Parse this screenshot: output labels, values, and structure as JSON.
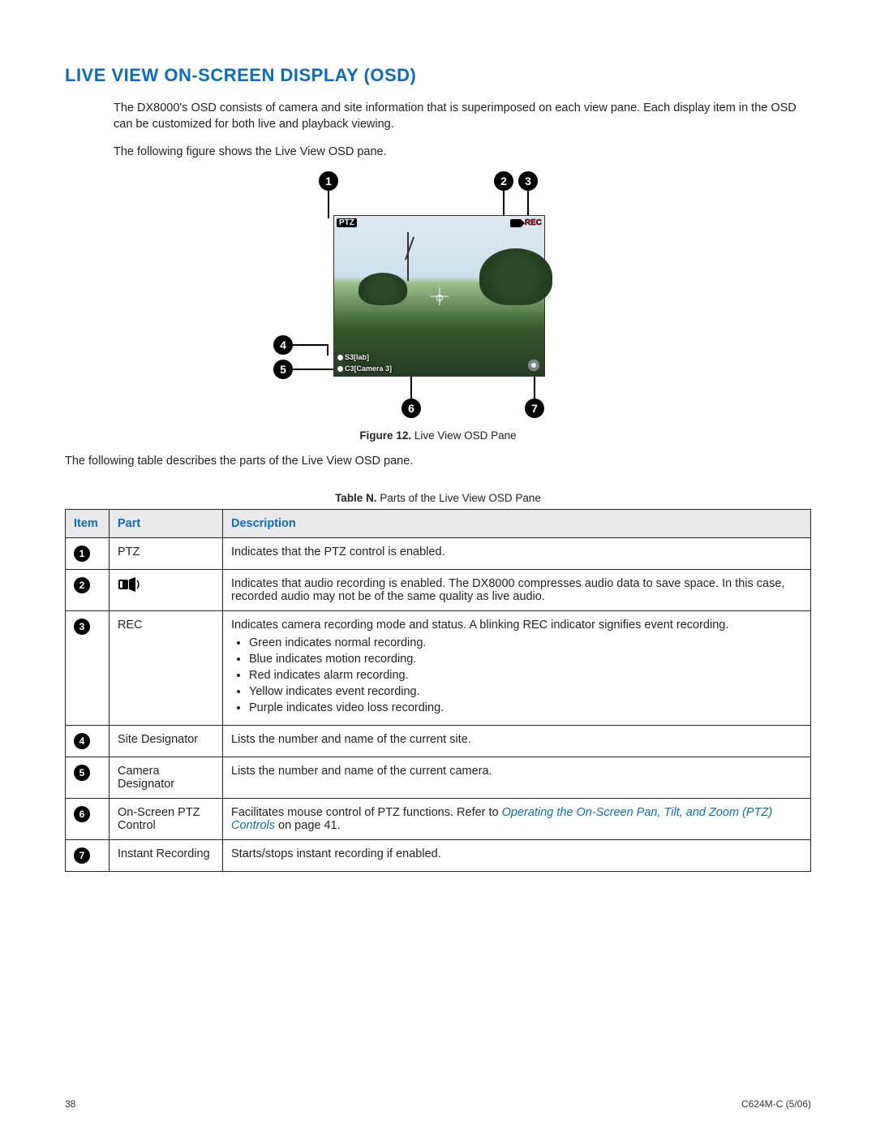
{
  "heading": "LIVE VIEW ON-SCREEN DISPLAY (OSD)",
  "intro1": "The DX8000's OSD consists of camera and site information that is superimposed on each view pane. Each display item in the OSD can be customized for both live and playback viewing.",
  "intro2": "The following figure shows the Live View OSD pane.",
  "osd_overlay": {
    "ptz": "PTZ",
    "rec": "REC",
    "site_label": "S3[lab]",
    "camera_label": "C3[Camera 3]"
  },
  "figure_label_prefix": "Figure 12.",
  "figure_label_text": "  Live View OSD Pane",
  "intro3": "The following table describes the parts of the Live View OSD pane.",
  "table_label_prefix": "Table N.",
  "table_label_text": "  Parts of the Live View OSD Pane",
  "columns": {
    "item": "Item",
    "part": "Part",
    "desc": "Description"
  },
  "rows": [
    {
      "num": "1",
      "part": "PTZ",
      "desc": "Indicates that the PTZ control is enabled."
    },
    {
      "num": "2",
      "part_icon": "audio-icon",
      "desc": "Indicates that audio recording is enabled. The DX8000 compresses audio data to save space. In this case, recorded audio may not be of the same quality as live audio."
    },
    {
      "num": "3",
      "part": "REC",
      "desc": "Indicates camera recording mode and status. A blinking REC indicator signifies event recording.",
      "bullets": [
        "Green indicates normal recording.",
        "Blue indicates motion recording.",
        "Red indicates alarm recording.",
        "Yellow indicates event recording.",
        "Purple indicates video loss recording."
      ]
    },
    {
      "num": "4",
      "part": "Site Designator",
      "desc": "Lists the number and name of the current site."
    },
    {
      "num": "5",
      "part": "Camera Designator",
      "desc": "Lists the number and name of the current camera."
    },
    {
      "num": "6",
      "part": "On-Screen PTZ Control",
      "desc_pre": "Facilitates mouse control of PTZ functions. Refer to ",
      "xref": "Operating the On-Screen Pan, Tilt, and Zoom (PTZ) Controls",
      "desc_post": " on page 41."
    },
    {
      "num": "7",
      "part": "Instant Recording",
      "desc": "Starts/stops instant recording if enabled."
    }
  ],
  "footer": {
    "page": "38",
    "doc": "C624M-C (5/06)"
  }
}
